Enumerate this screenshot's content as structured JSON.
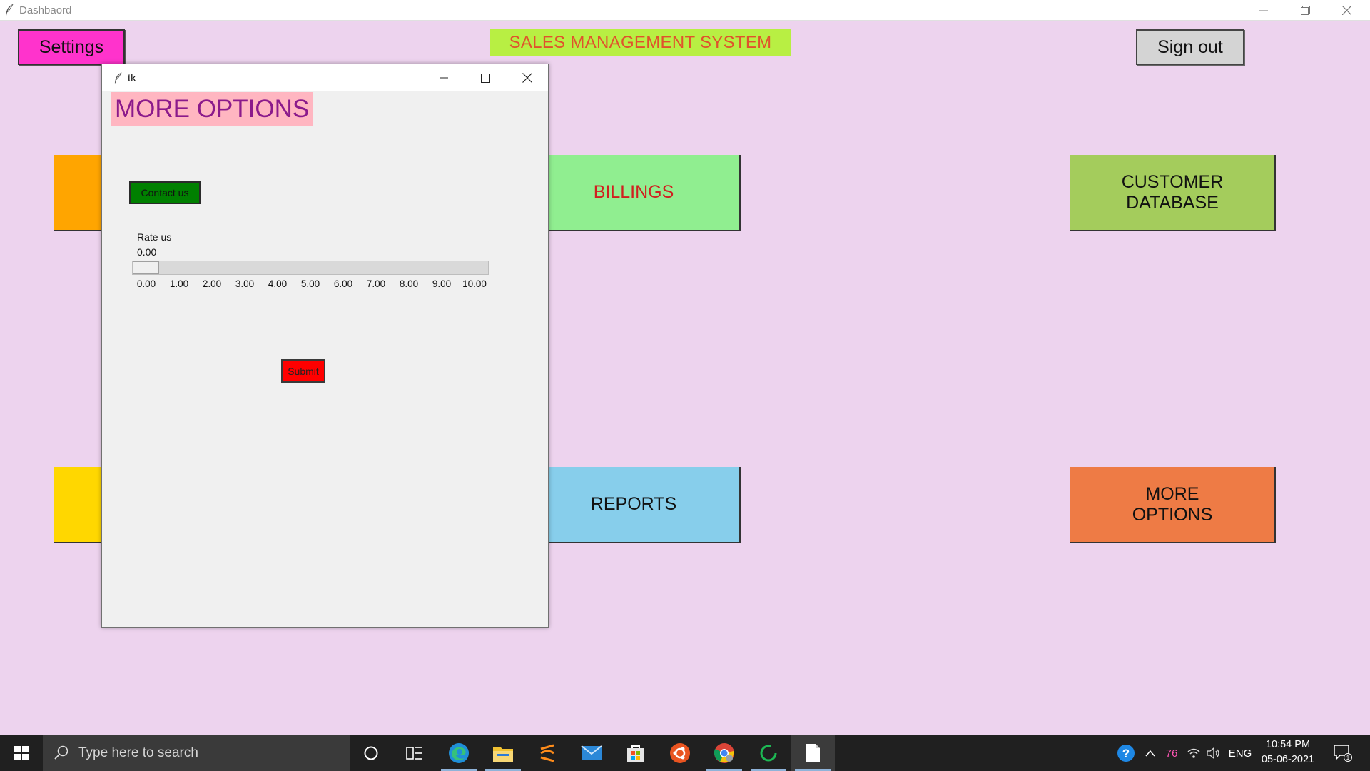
{
  "main_window": {
    "title": "Dashbaord"
  },
  "header": {
    "settings_label": "Settings",
    "app_title": "SALES MANAGEMENT SYSTEM",
    "signout_label": "Sign out"
  },
  "tiles": {
    "billings": "BILLINGS",
    "reports": "REPORTS",
    "customer_line1": "CUSTOMER",
    "customer_line2": "DATABASE",
    "more_line1": "MORE",
    "more_line2": "OPTIONS"
  },
  "popup": {
    "title": "tk",
    "heading": "MORE OPTIONS",
    "contact_label": "Contact us",
    "rate_label": "Rate us",
    "rate_value": "0.00",
    "slider": {
      "min": 0,
      "max": 10,
      "value": 0,
      "ticks": [
        "0.00",
        "1.00",
        "2.00",
        "3.00",
        "4.00",
        "5.00",
        "6.00",
        "7.00",
        "8.00",
        "9.00",
        "10.00"
      ]
    },
    "submit_label": "Submit"
  },
  "colors": {
    "background": "#edd3ee",
    "settings": "#ff33cc",
    "app_title_bg": "#b8ef43",
    "app_title_text": "#e0532c",
    "billings": "#90ee90",
    "reports": "#87ceeb",
    "customer": "#a4cc5c",
    "more_options": "#ee7b45",
    "contact": "#008000",
    "submit": "#ff0000",
    "heading_bg": "#ffb6c1",
    "heading_text": "#8b1a8b"
  },
  "taskbar": {
    "search_placeholder": "Type here to search",
    "apps": [
      "cortana-icon",
      "task-view-icon",
      "edge-icon",
      "file-explorer-icon",
      "sublime-icon",
      "mail-icon",
      "store-icon",
      "ubuntu-icon",
      "chrome-icon",
      "spinner-app-icon",
      "notepad-icon"
    ],
    "tray": {
      "temperature": "76",
      "language": "ENG",
      "time": "10:54 PM",
      "date": "05-06-2021",
      "notification_count": "1"
    }
  }
}
